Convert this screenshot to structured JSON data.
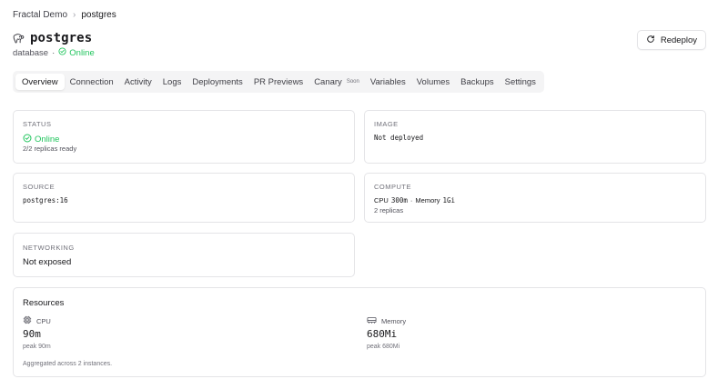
{
  "breadcrumb": {
    "parent": "Fractal Demo",
    "separator": "›",
    "current": "postgres"
  },
  "header": {
    "title": "postgres",
    "type_label": "database",
    "dot": "·",
    "status": "Online",
    "redeploy_label": "Redeploy"
  },
  "tabs": [
    {
      "label": "Overview",
      "active": true
    },
    {
      "label": "Connection"
    },
    {
      "label": "Activity"
    },
    {
      "label": "Logs"
    },
    {
      "label": "Deployments"
    },
    {
      "label": "PR Previews"
    },
    {
      "label": "Canary",
      "badge": "Soon"
    },
    {
      "label": "Variables"
    },
    {
      "label": "Volumes"
    },
    {
      "label": "Backups"
    },
    {
      "label": "Settings"
    }
  ],
  "cards": {
    "status": {
      "label": "STATUS",
      "value": "Online",
      "note": "2/2 replicas ready"
    },
    "image": {
      "label": "IMAGE",
      "value": "Not deployed"
    },
    "source": {
      "label": "SOURCE",
      "value": "postgres:16"
    },
    "compute": {
      "label": "COMPUTE",
      "cpu_prefix": "CPU",
      "cpu": "300m",
      "sep": "·",
      "mem_prefix": "Memory",
      "mem": "1Gi",
      "note": "2 replicas"
    },
    "networking": {
      "label": "NETWORKING",
      "value": "Not exposed"
    }
  },
  "resources": {
    "title": "Resources",
    "cpu": {
      "label": "CPU",
      "value": "90m",
      "peak": "peak 90m"
    },
    "memory": {
      "label": "Memory",
      "value": "680Mi",
      "peak": "peak 680Mi"
    },
    "note": "Aggregated across 2 instances."
  },
  "colors": {
    "online": "#22c55e",
    "border": "#e4e4e7",
    "tabs_bg": "#f4f4f5"
  },
  "icons": {
    "title": "elephant-icon",
    "redeploy": "refresh-icon",
    "status": "check-circle-icon",
    "cpu": "chip-icon",
    "memory": "memory-icon"
  }
}
